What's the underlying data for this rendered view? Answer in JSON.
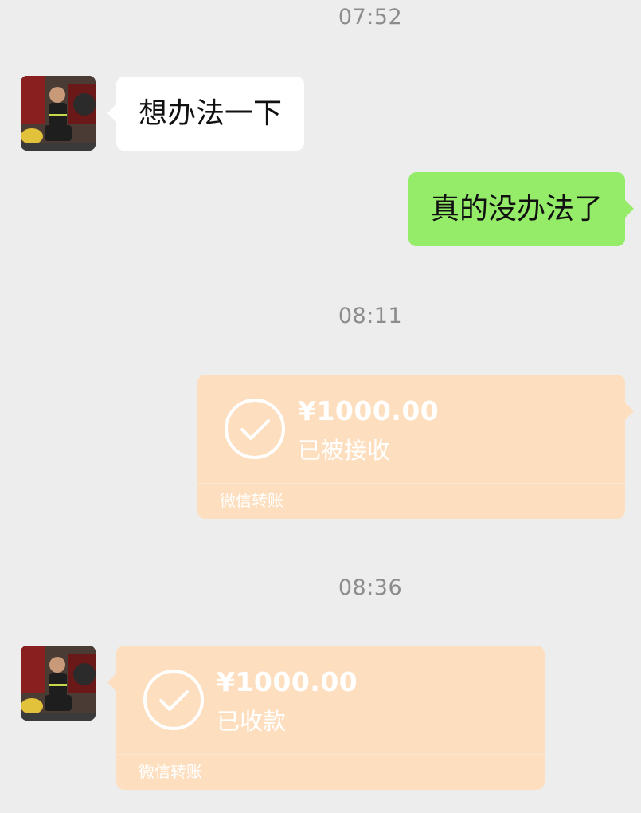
{
  "messages": [
    {
      "type": "timestamp",
      "text": "07:52"
    },
    {
      "type": "text",
      "direction": "incoming",
      "text": "想办法一下"
    },
    {
      "type": "text",
      "direction": "outgoing",
      "text": "真的没办法了"
    },
    {
      "type": "timestamp",
      "text": "08:11"
    },
    {
      "type": "transfer",
      "direction": "outgoing",
      "amount": "¥1000.00",
      "status": "已被接收",
      "label": "微信转账"
    },
    {
      "type": "timestamp",
      "text": "08:36"
    },
    {
      "type": "transfer",
      "direction": "incoming",
      "amount": "¥1000.00",
      "status": "已收款",
      "label": "微信转账"
    }
  ],
  "colors": {
    "background": "#ededed",
    "incoming_bubble": "#ffffff",
    "outgoing_bubble": "#95ec69",
    "transfer_card": "#fddfbf",
    "timestamp_text": "#8c8c8c"
  },
  "icons": {
    "transfer_status": "check-circle-icon",
    "contact_avatar": "avatar-photo"
  }
}
